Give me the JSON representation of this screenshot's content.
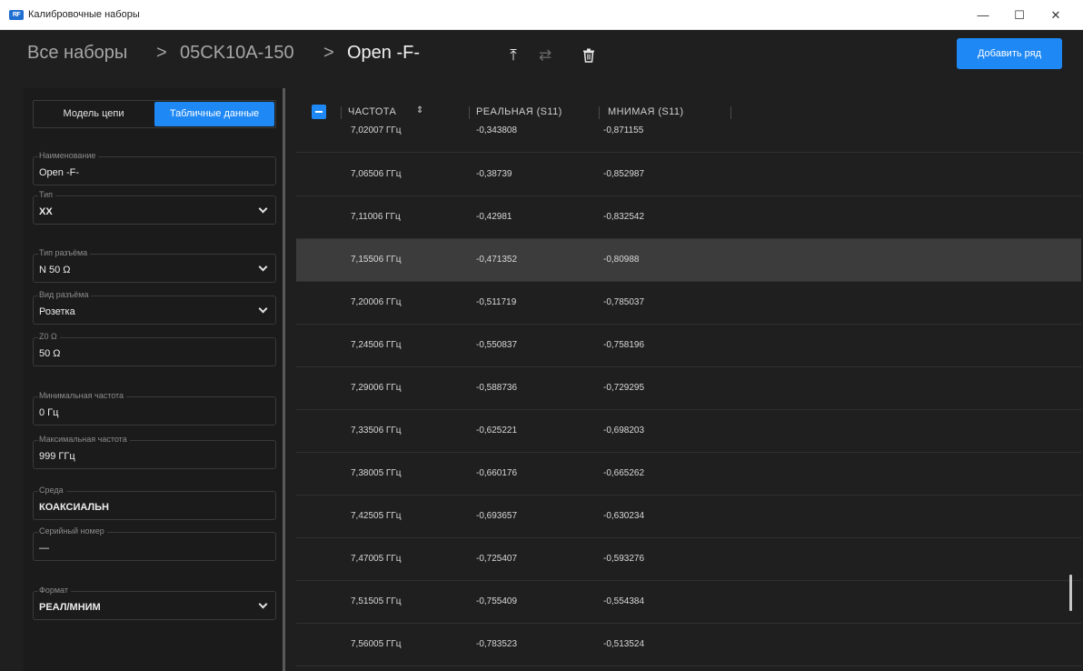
{
  "window": {
    "title": "Калибровочные наборы",
    "logo_text": "RF"
  },
  "breadcrumb": {
    "root": "Все наборы",
    "sep": ">",
    "kit": "05CK10A-150",
    "current": "Open -F-"
  },
  "toolbar": {
    "add_row_label": "Добавить ряд"
  },
  "tabs": {
    "model": "Модель цепи",
    "table": "Табличные данные"
  },
  "fields": {
    "name": {
      "label": "Наименование",
      "value": "Open -F-"
    },
    "type": {
      "label": "Тип",
      "value": "XX"
    },
    "connector_type": {
      "label": "Тип разъёма",
      "value": "N 50 Ω"
    },
    "connector_kind": {
      "label": "Вид разъёма",
      "value": "Розетка"
    },
    "z0": {
      "label": "Z0 Ω",
      "value": "50 Ω"
    },
    "min_freq": {
      "label": "Минимальная частота",
      "value": "0 Гц"
    },
    "max_freq": {
      "label": "Максимальная частота",
      "value": "999 ГГц"
    },
    "medium": {
      "label": "Среда",
      "value": "КОАКСИАЛЬН"
    },
    "serial": {
      "label": "Серийный номер",
      "value": "—"
    },
    "format": {
      "label": "Формат",
      "value": "РЕАЛ/МНИМ"
    }
  },
  "table": {
    "columns": [
      "ЧАСТОТА",
      "РЕАЛЬНАЯ (S11)",
      "МНИМАЯ (S11)"
    ],
    "partial_row": [
      "7,02007 ГГц",
      "-0,343808",
      "-0,871155"
    ],
    "rows": [
      [
        "7,06506 ГГц",
        "-0,38739",
        "-0,852987"
      ],
      [
        "7,11006 ГГц",
        "-0,42981",
        "-0,832542"
      ],
      [
        "7,15506 ГГц",
        "-0,471352",
        "-0,80988"
      ],
      [
        "7,20006 ГГц",
        "-0,511719",
        "-0,785037"
      ],
      [
        "7,24506 ГГц",
        "-0,550837",
        "-0,758196"
      ],
      [
        "7,29006 ГГц",
        "-0,588736",
        "-0,729295"
      ],
      [
        "7,33506 ГГц",
        "-0,625221",
        "-0,698203"
      ],
      [
        "7,38005 ГГц",
        "-0,660176",
        "-0,665262"
      ],
      [
        "7,42505 ГГц",
        "-0,693657",
        "-0,630234"
      ],
      [
        "7,47005 ГГц",
        "-0,725407",
        "-0,593276"
      ],
      [
        "7,51505 ГГц",
        "-0,755409",
        "-0,554384"
      ],
      [
        "7,56005 ГГц",
        "-0,783523",
        "-0,513524"
      ]
    ],
    "selected_index": 2
  }
}
